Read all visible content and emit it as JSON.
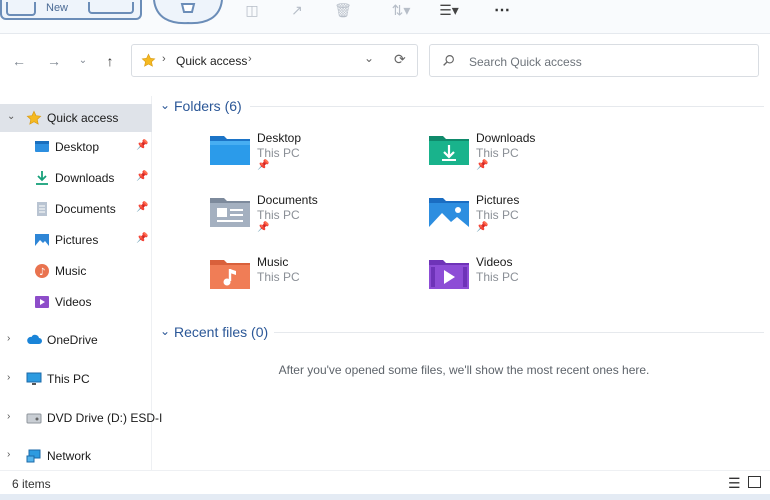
{
  "toolbar": {
    "new_label": "New",
    "icons": [
      "cut-icon",
      "share-icon",
      "delete-icon",
      "sort-icon",
      "view-icon",
      "more-icon"
    ]
  },
  "address": {
    "crumb": "Quick access",
    "search_placeholder": "Search Quick access"
  },
  "sidebar": {
    "items": [
      {
        "label": "Quick access",
        "icon": "star-icon",
        "selected": true
      },
      {
        "label": "Desktop",
        "icon": "desktop-icon",
        "pinned": true
      },
      {
        "label": "Downloads",
        "icon": "downloads-icon",
        "pinned": true
      },
      {
        "label": "Documents",
        "icon": "documents-icon",
        "pinned": true
      },
      {
        "label": "Pictures",
        "icon": "pictures-icon",
        "pinned": true
      },
      {
        "label": "Music",
        "icon": "music-icon"
      },
      {
        "label": "Videos",
        "icon": "videos-icon"
      },
      {
        "label": "OneDrive",
        "icon": "cloud-icon"
      },
      {
        "label": "This PC",
        "icon": "monitor-icon"
      },
      {
        "label": "DVD Drive (D:) ESD-I",
        "icon": "dvd-icon"
      },
      {
        "label": "Network",
        "icon": "network-icon"
      }
    ]
  },
  "folders": {
    "header": "Folders (6)",
    "items": [
      {
        "name": "Desktop",
        "location": "This PC",
        "pinned": true
      },
      {
        "name": "Downloads",
        "location": "This PC",
        "pinned": true
      },
      {
        "name": "Documents",
        "location": "This PC",
        "pinned": true
      },
      {
        "name": "Pictures",
        "location": "This PC",
        "pinned": true
      },
      {
        "name": "Music",
        "location": "This PC",
        "pinned": false
      },
      {
        "name": "Videos",
        "location": "This PC",
        "pinned": false
      }
    ]
  },
  "recent": {
    "header": "Recent files (0)",
    "empty_message": "After you've opened some files, we'll show the most recent ones here."
  },
  "status": {
    "count": "6 items"
  },
  "colors": {
    "accent": "#2b5797",
    "selected_bg": "#dfe3e9"
  }
}
